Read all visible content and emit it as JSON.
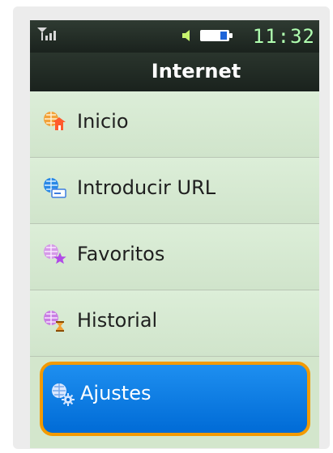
{
  "statusbar": {
    "time": "11:32",
    "signal_icon": "signal-icon",
    "speaker_icon": "speaker-icon",
    "battery_icon": "battery-icon"
  },
  "title": "Internet",
  "menu": {
    "items": [
      {
        "label": "Inicio",
        "icon": "home-globe-icon",
        "selected": false
      },
      {
        "label": "Introducir URL",
        "icon": "url-globe-icon",
        "selected": false
      },
      {
        "label": "Favoritos",
        "icon": "favorites-globe-icon",
        "selected": false
      },
      {
        "label": "Historial",
        "icon": "history-globe-icon",
        "selected": false
      },
      {
        "label": "Ajustes",
        "icon": "settings-globe-icon",
        "selected": true
      }
    ]
  },
  "colors": {
    "screen_bg": "#d3e6cc",
    "selection_bg": "#006bd6",
    "selection_border": "#f39a00",
    "status_time": "#b0ffb0"
  }
}
